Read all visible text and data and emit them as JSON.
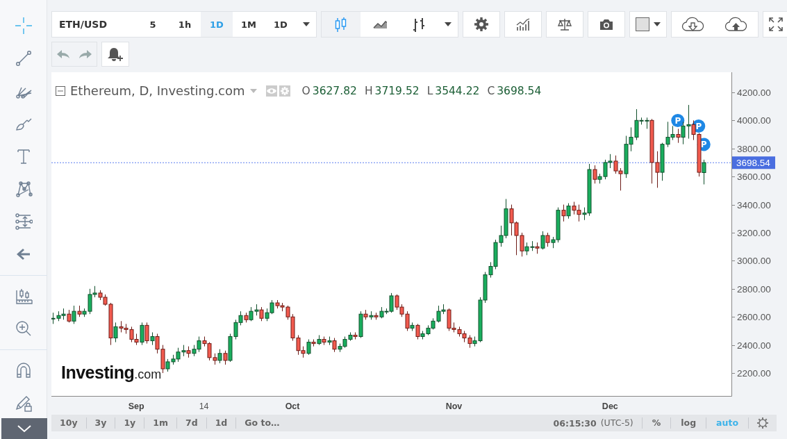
{
  "left_toolbar": {
    "tools": [
      {
        "kind": "crosshair",
        "selected": true
      },
      {
        "kind": "trend-line",
        "selected": false
      },
      {
        "kind": "pitchfork",
        "selected": false
      },
      {
        "kind": "brush",
        "selected": false
      },
      {
        "kind": "text",
        "selected": false
      },
      {
        "kind": "pattern",
        "selected": false
      },
      {
        "kind": "measure",
        "selected": false
      },
      {
        "kind": "arrow",
        "selected": false
      },
      {
        "kind": "divider"
      },
      {
        "kind": "candles-ruler",
        "selected": false
      },
      {
        "kind": "zoom",
        "selected": false
      },
      {
        "kind": "divider"
      },
      {
        "kind": "magnet",
        "selected": false
      },
      {
        "kind": "lock-pencil",
        "selected": false
      }
    ]
  },
  "toolbar": {
    "symbol": "ETH/USD",
    "intervals": [
      {
        "label": "5",
        "selected": false
      },
      {
        "label": "1h",
        "selected": false
      },
      {
        "label": "1D",
        "selected": true
      },
      {
        "label": "1M",
        "selected": false
      },
      {
        "label": "1D",
        "selected": false
      }
    ],
    "chart_styles": [
      {
        "kind": "candles",
        "selected": true
      },
      {
        "kind": "area",
        "selected": false
      },
      {
        "kind": "bars",
        "selected": false
      }
    ]
  },
  "legend": {
    "title": "Ethereum, D, Investing.com",
    "ohlc": [
      {
        "key": "O",
        "value": "3627.82"
      },
      {
        "key": "H",
        "value": "3719.52"
      },
      {
        "key": "L",
        "value": "3544.22"
      },
      {
        "key": "C",
        "value": "3698.54"
      }
    ]
  },
  "chart": {
    "logo": {
      "brand": "Investing",
      "suffix": ".com"
    },
    "chart_data": {
      "type": "candlestick",
      "ylim": [
        2037,
        4343
      ],
      "yticks": [
        {
          "value": 2200,
          "label": "2200.00"
        },
        {
          "value": 2400,
          "label": "2400.00"
        },
        {
          "value": 2600,
          "label": "2600.00"
        },
        {
          "value": 2800,
          "label": "2800.00"
        },
        {
          "value": 3000,
          "label": "3000.00"
        },
        {
          "value": 3200,
          "label": "3200.00"
        },
        {
          "value": 3400,
          "label": "3400.00"
        },
        {
          "value": 3600,
          "label": "3600.00"
        },
        {
          "value": 3800,
          "label": "3800.00"
        },
        {
          "value": 4000,
          "label": "4000.00"
        },
        {
          "value": 4200,
          "label": "4200.00"
        }
      ],
      "categories": [
        null,
        null,
        null,
        null,
        null,
        null,
        null,
        null,
        null,
        null,
        null,
        null,
        null,
        null,
        null,
        null,
        "Sep",
        null,
        null,
        null,
        null,
        null,
        null,
        null,
        null,
        null,
        null,
        null,
        null,
        "14",
        null,
        null,
        null,
        null,
        null,
        null,
        null,
        null,
        null,
        null,
        null,
        null,
        null,
        null,
        null,
        null,
        "Oct",
        null,
        null,
        null,
        null,
        null,
        null,
        null,
        null,
        null,
        null,
        null,
        null,
        null,
        null,
        null,
        null,
        null,
        null,
        null,
        null,
        null,
        null,
        null,
        null,
        null,
        null,
        null,
        null,
        null,
        null,
        "Nov",
        null,
        null,
        null,
        null,
        null,
        null,
        null,
        null,
        null,
        null,
        null,
        null,
        null,
        null,
        null,
        null,
        null,
        null,
        null,
        null,
        null,
        null,
        null,
        null,
        null,
        null,
        null,
        null,
        null,
        "Dec",
        null,
        null,
        null,
        null,
        null,
        null,
        null,
        null,
        null,
        null,
        null,
        null,
        null,
        null,
        null,
        null,
        null,
        null
      ],
      "ohlc": [
        [
          2590,
          2630,
          2550,
          2590
        ],
        [
          2590,
          2640,
          2570,
          2610
        ],
        [
          2610,
          2660,
          2580,
          2620
        ],
        [
          2620,
          2650,
          2560,
          2570
        ],
        [
          2570,
          2680,
          2550,
          2640
        ],
        [
          2640,
          2680,
          2600,
          2620
        ],
        [
          2620,
          2660,
          2600,
          2640
        ],
        [
          2640,
          2800,
          2620,
          2760
        ],
        [
          2760,
          2820,
          2740,
          2770
        ],
        [
          2770,
          2790,
          2720,
          2740
        ],
        [
          2740,
          2760,
          2680,
          2690
        ],
        [
          2690,
          2700,
          2400,
          2450
        ],
        [
          2450,
          2560,
          2420,
          2530
        ],
        [
          2530,
          2570,
          2490,
          2520
        ],
        [
          2520,
          2550,
          2480,
          2510
        ],
        [
          2510,
          2530,
          2420,
          2440
        ],
        [
          2440,
          2480,
          2400,
          2420
        ],
        [
          2420,
          2560,
          2400,
          2540
        ],
        [
          2540,
          2560,
          2410,
          2430
        ],
        [
          2430,
          2490,
          2400,
          2460
        ],
        [
          2460,
          2480,
          2340,
          2370
        ],
        [
          2370,
          2400,
          2200,
          2230
        ],
        [
          2230,
          2300,
          2210,
          2280
        ],
        [
          2280,
          2330,
          2260,
          2300
        ],
        [
          2300,
          2380,
          2280,
          2350
        ],
        [
          2350,
          2400,
          2320,
          2360
        ],
        [
          2360,
          2390,
          2310,
          2340
        ],
        [
          2340,
          2400,
          2320,
          2370
        ],
        [
          2370,
          2460,
          2350,
          2430
        ],
        [
          2430,
          2460,
          2390,
          2410
        ],
        [
          2410,
          2420,
          2290,
          2310
        ],
        [
          2310,
          2340,
          2260,
          2290
        ],
        [
          2290,
          2370,
          2270,
          2340
        ],
        [
          2340,
          2360,
          2260,
          2290
        ],
        [
          2290,
          2480,
          2280,
          2460
        ],
        [
          2460,
          2580,
          2440,
          2560
        ],
        [
          2560,
          2640,
          2540,
          2610
        ],
        [
          2610,
          2630,
          2560,
          2580
        ],
        [
          2580,
          2670,
          2570,
          2640
        ],
        [
          2640,
          2690,
          2610,
          2650
        ],
        [
          2650,
          2670,
          2570,
          2590
        ],
        [
          2590,
          2660,
          2570,
          2630
        ],
        [
          2630,
          2720,
          2620,
          2700
        ],
        [
          2700,
          2720,
          2660,
          2680
        ],
        [
          2680,
          2700,
          2640,
          2670
        ],
        [
          2670,
          2680,
          2580,
          2600
        ],
        [
          2600,
          2620,
          2430,
          2450
        ],
        [
          2450,
          2470,
          2330,
          2360
        ],
        [
          2360,
          2390,
          2310,
          2340
        ],
        [
          2340,
          2440,
          2330,
          2420
        ],
        [
          2420,
          2440,
          2390,
          2410
        ],
        [
          2410,
          2470,
          2400,
          2440
        ],
        [
          2440,
          2460,
          2400,
          2420
        ],
        [
          2420,
          2460,
          2400,
          2430
        ],
        [
          2430,
          2450,
          2350,
          2370
        ],
        [
          2370,
          2410,
          2350,
          2390
        ],
        [
          2390,
          2460,
          2380,
          2440
        ],
        [
          2440,
          2490,
          2430,
          2470
        ],
        [
          2470,
          2490,
          2440,
          2460
        ],
        [
          2460,
          2640,
          2450,
          2620
        ],
        [
          2620,
          2650,
          2580,
          2600
        ],
        [
          2600,
          2640,
          2580,
          2610
        ],
        [
          2610,
          2630,
          2580,
          2600
        ],
        [
          2600,
          2670,
          2590,
          2640
        ],
        [
          2640,
          2660,
          2620,
          2640
        ],
        [
          2640,
          2770,
          2630,
          2750
        ],
        [
          2750,
          2760,
          2650,
          2670
        ],
        [
          2670,
          2690,
          2600,
          2620
        ],
        [
          2620,
          2640,
          2500,
          2520
        ],
        [
          2520,
          2560,
          2500,
          2540
        ],
        [
          2540,
          2550,
          2440,
          2460
        ],
        [
          2460,
          2500,
          2440,
          2480
        ],
        [
          2480,
          2540,
          2470,
          2520
        ],
        [
          2520,
          2590,
          2510,
          2570
        ],
        [
          2570,
          2680,
          2560,
          2640
        ],
        [
          2640,
          2690,
          2620,
          2650
        ],
        [
          2650,
          2660,
          2500,
          2520
        ],
        [
          2520,
          2560,
          2490,
          2510
        ],
        [
          2510,
          2530,
          2460,
          2480
        ],
        [
          2480,
          2500,
          2420,
          2450
        ],
        [
          2450,
          2470,
          2380,
          2410
        ],
        [
          2410,
          2460,
          2390,
          2430
        ],
        [
          2430,
          2740,
          2420,
          2720
        ],
        [
          2720,
          2920,
          2700,
          2900
        ],
        [
          2900,
          2990,
          2880,
          2960
        ],
        [
          2960,
          3150,
          2940,
          3130
        ],
        [
          3130,
          3250,
          3100,
          3180
        ],
        [
          3180,
          3440,
          3160,
          3370
        ],
        [
          3370,
          3400,
          3180,
          3270
        ],
        [
          3270,
          3280,
          3040,
          3180
        ],
        [
          3180,
          3200,
          3030,
          3070
        ],
        [
          3070,
          3130,
          3040,
          3100
        ],
        [
          3100,
          3140,
          3070,
          3100
        ],
        [
          3100,
          3130,
          3050,
          3090
        ],
        [
          3090,
          3210,
          3080,
          3180
        ],
        [
          3180,
          3200,
          3100,
          3130
        ],
        [
          3130,
          3170,
          3090,
          3150
        ],
        [
          3150,
          3380,
          3130,
          3360
        ],
        [
          3360,
          3400,
          3280,
          3320
        ],
        [
          3320,
          3410,
          3300,
          3390
        ],
        [
          3390,
          3420,
          3330,
          3360
        ],
        [
          3360,
          3400,
          3280,
          3330
        ],
        [
          3330,
          3380,
          3290,
          3340
        ],
        [
          3340,
          3690,
          3320,
          3650
        ],
        [
          3650,
          3680,
          3550,
          3580
        ],
        [
          3580,
          3620,
          3550,
          3600
        ],
        [
          3600,
          3720,
          3580,
          3700
        ],
        [
          3700,
          3760,
          3660,
          3710
        ],
        [
          3710,
          3750,
          3620,
          3640
        ],
        [
          3640,
          3660,
          3500,
          3620
        ],
        [
          3620,
          3890,
          3590,
          3830
        ],
        [
          3830,
          3950,
          3780,
          3880
        ],
        [
          3880,
          4080,
          3860,
          4000
        ],
        [
          4000,
          4020,
          3970,
          4000
        ],
        [
          4000,
          4020,
          3940,
          4000
        ],
        [
          4000,
          4010,
          3550,
          3700
        ],
        [
          3700,
          3780,
          3520,
          3630
        ],
        [
          3630,
          3840,
          3570,
          3830
        ],
        [
          3830,
          3990,
          3810,
          3880
        ],
        [
          3880,
          3960,
          3860,
          3900
        ],
        [
          3900,
          3940,
          3840,
          3880
        ],
        [
          3880,
          3990,
          3830,
          3960
        ],
        [
          3960,
          4110,
          3870,
          3970
        ],
        [
          3970,
          4000,
          3860,
          3900
        ],
        [
          3900,
          3910,
          3600,
          3630
        ],
        [
          3628,
          3720,
          3544,
          3699
        ]
      ],
      "ref_lines": [
        {
          "axis": "y",
          "value": 3698.54,
          "label": "3698.54"
        }
      ],
      "annotations": [
        "P",
        "P",
        "P"
      ]
    }
  },
  "bottom_bar": {
    "ranges": [
      "10y",
      "3y",
      "1y",
      "1m",
      "7d",
      "1d"
    ],
    "goto": "Go to…",
    "time": "06:15:30",
    "timezone": "(UTC-5)",
    "scale_options": [
      {
        "label": "%",
        "selected": false
      },
      {
        "label": "log",
        "selected": false
      },
      {
        "label": "auto",
        "selected": true
      }
    ]
  }
}
